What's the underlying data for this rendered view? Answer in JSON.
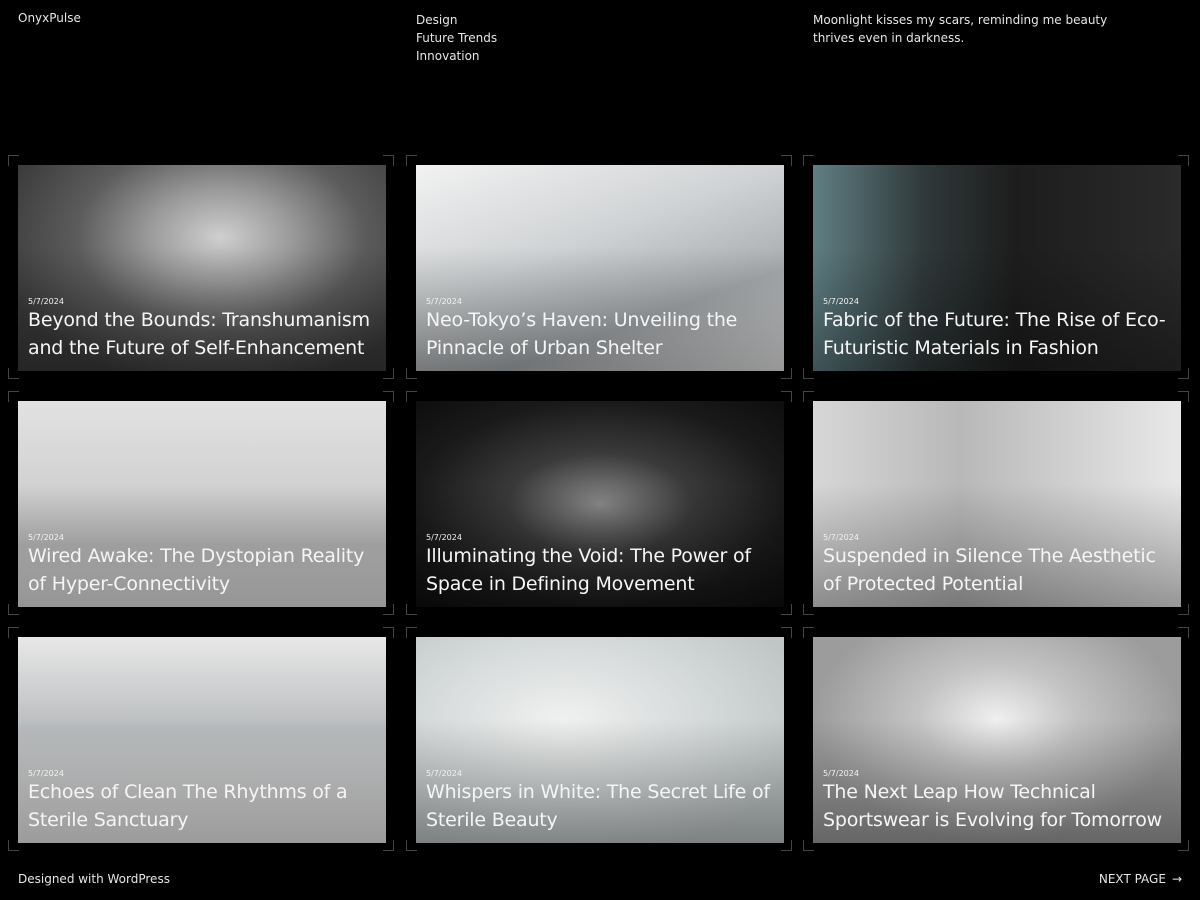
{
  "header": {
    "site_title": "OnyxPulse",
    "nav": [
      "Design",
      "Future Trends",
      "Innovation"
    ],
    "tagline": "Moonlight kisses my scars, reminding me beauty thrives even in darkness."
  },
  "posts": [
    {
      "date": "5/7/2024",
      "title": "Beyond the Bounds: Transhumanism and the Future of Self-Enhancement"
    },
    {
      "date": "5/7/2024",
      "title": "Neo-Tokyo’s Haven: Unveiling the Pinnacle of Urban Shelter"
    },
    {
      "date": "5/7/2024",
      "title": "Fabric of the Future: The Rise of Eco-Futuristic Materials in Fashion"
    },
    {
      "date": "5/7/2024",
      "title": "Wired Awake: The Dystopian Reality of Hyper-Connectivity"
    },
    {
      "date": "5/7/2024",
      "title": "Illuminating the Void: The Power of Space in Defining Movement"
    },
    {
      "date": "5/7/2024",
      "title": "Suspended in Silence The Aesthetic of Protected Potential"
    },
    {
      "date": "5/7/2024",
      "title": "Echoes of Clean The Rhythms of a Sterile Sanctuary"
    },
    {
      "date": "5/7/2024",
      "title": "Whispers in White: The Secret Life of Sterile Beauty"
    },
    {
      "date": "5/7/2024",
      "title": "The Next Leap How Technical Sportswear is Evolving for Tomorrow"
    }
  ],
  "footer": {
    "credit": "Designed with WordPress",
    "next_label": "NEXT PAGE",
    "next_arrow": "→"
  }
}
